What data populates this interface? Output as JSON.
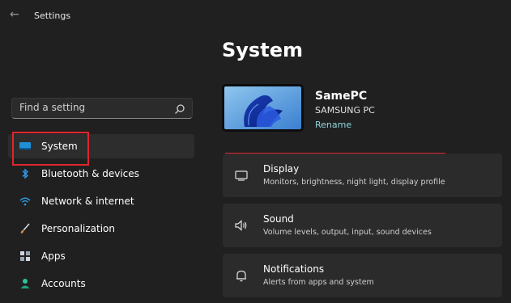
{
  "window": {
    "title": "Settings"
  },
  "search": {
    "placeholder": "Find a setting"
  },
  "sidebar": {
    "items": [
      {
        "label": "System",
        "icon": "monitor-icon",
        "active": true
      },
      {
        "label": "Bluetooth & devices",
        "icon": "bluetooth-icon"
      },
      {
        "label": "Network & internet",
        "icon": "wifi-icon"
      },
      {
        "label": "Personalization",
        "icon": "brush-icon"
      },
      {
        "label": "Apps",
        "icon": "apps-icon"
      },
      {
        "label": "Accounts",
        "icon": "person-icon"
      }
    ]
  },
  "main": {
    "title": "System",
    "device": {
      "name": "SamePC",
      "model": "SAMSUNG PC",
      "rename_label": "Rename"
    },
    "cards": [
      {
        "title": "Display",
        "subtitle": "Monitors, brightness, night light, display profile",
        "icon": "display-icon"
      },
      {
        "title": "Sound",
        "subtitle": "Volume levels, output, input, sound devices",
        "icon": "speaker-icon"
      },
      {
        "title": "Notifications",
        "subtitle": "Alerts from apps and system",
        "icon": "bell-icon"
      }
    ]
  },
  "colors": {
    "background": "#202020",
    "card": "#2b2b2b",
    "accent": "#8fd4d9",
    "highlight": "#e0262d"
  }
}
